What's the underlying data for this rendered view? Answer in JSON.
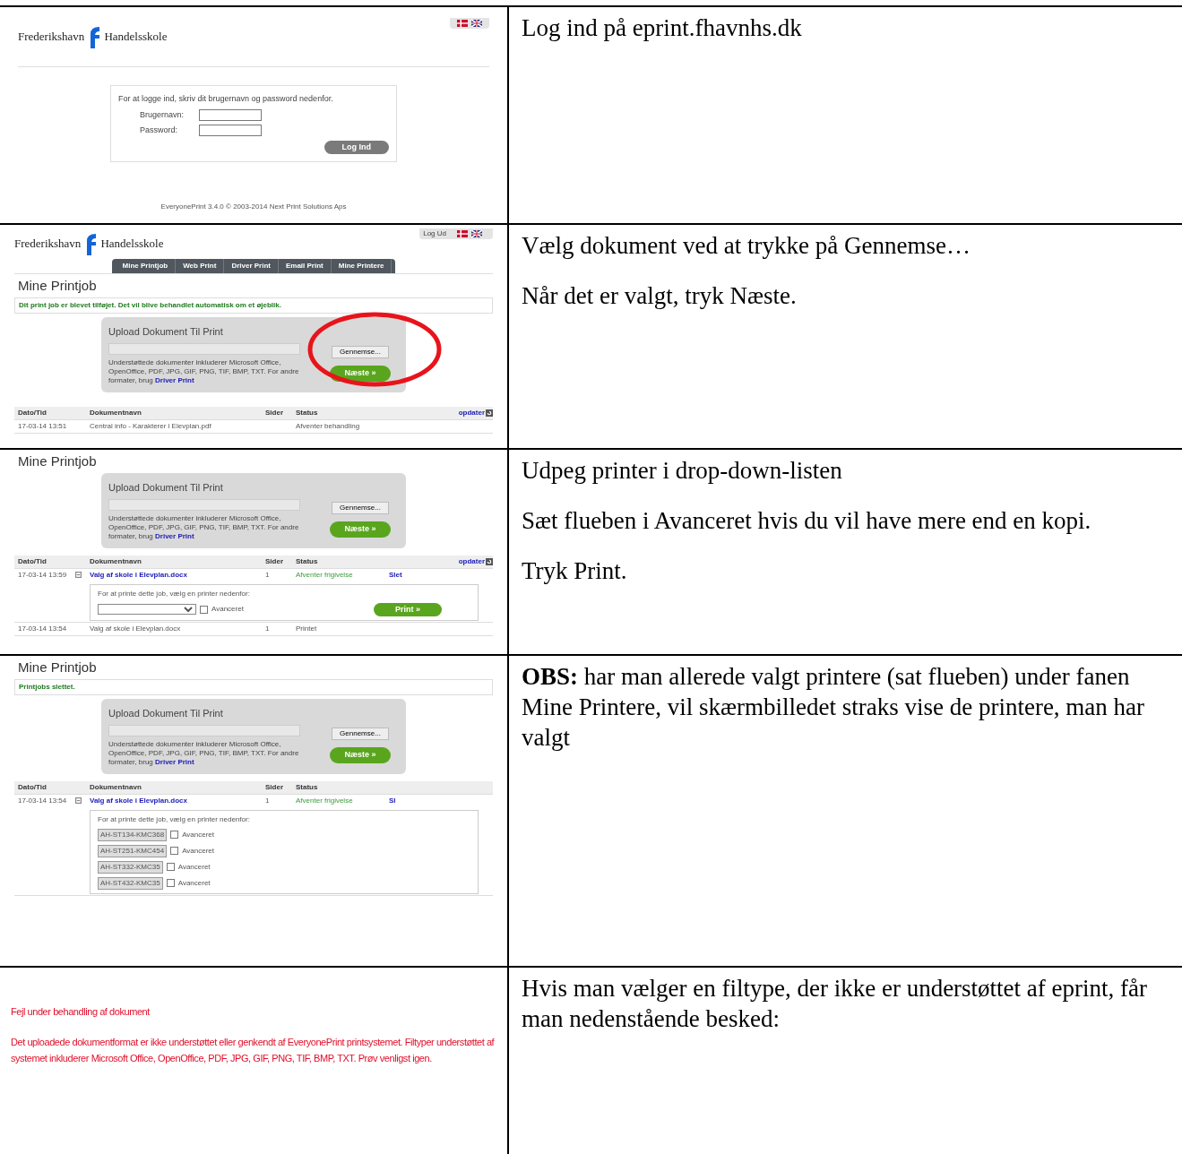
{
  "rows": [
    {
      "kind": "login",
      "shot": {
        "logo": {
          "left": "Frederikshavn",
          "right": "Handelsskole"
        },
        "prompt": "For at logge ind, skriv dit brugernavn og password nedenfor.",
        "fields": [
          {
            "label": "Brugernavn:"
          },
          {
            "label": "Password:"
          }
        ],
        "button": "Log Ind",
        "footer": "EveryonePrint 3.4.0 © 2003-2014 Next Print Solutions Aps"
      },
      "notes": [
        "Log ind på eprint.fhavnhs.dk"
      ]
    },
    {
      "kind": "jobs",
      "shot": {
        "logout": "Log Ud",
        "logo": {
          "left": "Frederikshavn",
          "right": "Handelsskole"
        },
        "tabs": [
          "Mine Printjob",
          "Web Print",
          "Driver Print",
          "Email Print",
          "Mine Printere"
        ],
        "heading": "Mine Printjob",
        "message": "Dit print job er blevet tilføjet. Det vil blive behandlet automatisk om et øjeblik.",
        "upload": {
          "title": "Upload Dokument Til Print",
          "browse": "Gennemse...",
          "info": "Understøttede dokumenter inkluderer Microsoft Office, OpenOffice, PDF, JPG, GIF, PNG, TIF, BMP, TXT. For andre formater, brug ",
          "link": "Driver Print",
          "next": "Næste »"
        },
        "highlight": true,
        "columns": [
          "Dato/Tid",
          "Dokumentnavn",
          "Sider",
          "Status"
        ],
        "refresh": "opdater",
        "jobs": [
          {
            "date": "17-03-14 13:51",
            "name": "Central info - Karakterer i Elevplan.pdf",
            "link": false,
            "pending": false,
            "status": "Afventer behandling"
          }
        ]
      },
      "notes": [
        "Vælg dokument ved at trykke på Gennemse…",
        "Når det er valgt, tryk Næste."
      ]
    },
    {
      "kind": "jobs",
      "shot": {
        "heading": "Mine Printjob",
        "upload": {
          "title": "Upload Dokument Til Print",
          "browse": "Gennemse...",
          "info": "Understøttede dokumenter inkluderer Microsoft Office, OpenOffice, PDF, JPG, GIF, PNG, TIF, BMP, TXT. For andre formater, brug ",
          "link": "Driver Print",
          "next": "Næste »"
        },
        "columns": [
          "Dato/Tid",
          "Dokumentnavn",
          "Sider",
          "Status"
        ],
        "refresh": "opdater",
        "jobs": [
          {
            "date": "17-03-14 13:59",
            "name": "Valg af skole i Elevplan.docx",
            "link": true,
            "expanded": true,
            "pages": "1",
            "pending": true,
            "status": "Afventer frigivelse",
            "action": "Slet",
            "detail": {
              "kind": "select",
              "prompt": "For at printe dette job, vælg en printer nedenfor:",
              "choices": [
                {
                  "advanced": "Avanceret",
                  "checked": false
                }
              ],
              "print": "Print »"
            }
          },
          {
            "date": "17-03-14 13:54",
            "name": "Valg af skole i Elevplan.docx",
            "link": false,
            "pages": "1",
            "pending": false,
            "status": "Printet"
          }
        ]
      },
      "notes": [
        "Udpeg printer i drop-down-listen",
        "Sæt flueben i Avanceret hvis du vil have mere end en kopi.",
        "Tryk Print."
      ]
    },
    {
      "kind": "jobs",
      "shot": {
        "heading": "Mine Printjob",
        "message": "Printjobs slettet.",
        "upload": {
          "title": "Upload Dokument Til Print",
          "browse": "Gennemse...",
          "info": "Understøttede dokumenter inkluderer Microsoft Office, OpenOffice, PDF, JPG, GIF, PNG, TIF, BMP, TXT. For andre formater, brug ",
          "link": "Driver Print",
          "next": "Næste »"
        },
        "columns": [
          "Dato/Tid",
          "Dokumentnavn",
          "Sider",
          "Status"
        ],
        "jobs": [
          {
            "date": "17-03-14 13:54",
            "name": "Valg af skole i Elevplan.docx",
            "link": true,
            "expanded": true,
            "pages": "1",
            "pending": true,
            "status": "Afventer frigivelse",
            "action": "Sl",
            "detail": {
              "kind": "printers",
              "prompt": "For at printe dette job, vælg en printer nedenfor:",
              "choices": [
                {
                  "printer": "AH-ST134-KMC368",
                  "advanced": "Avanceret",
                  "checked": false
                },
                {
                  "printer": "AH-ST251-KMC454",
                  "advanced": "Avanceret",
                  "checked": false
                },
                {
                  "printer": "AH-ST332-KMC35",
                  "advanced": "Avanceret",
                  "checked": false
                },
                {
                  "printer": "AH-ST432-KMC35",
                  "advanced": "Avanceret",
                  "checked": false
                }
              ]
            }
          }
        ]
      },
      "notes": [
        "**OBS:** har man allerede valgt printere (sat flueben) under fanen Mine Printere, vil skærmbilledet straks vise de printere, man har valgt"
      ]
    },
    {
      "kind": "error",
      "shot": {
        "title": "Fejl under behandling af dokument",
        "message": "Det uploadede dokumentformat er ikke understøttet eller genkendt af EveryonePrint printsystemet. Filtyper understøttet af systemet inkluderer Microsoft Office, OpenOffice, PDF, JPG, GIF, PNG, TIF, BMP, TXT. Prøv venligst igen."
      },
      "notes": [
        "Hvis man vælger en filtype, der ikke er understøttet af eprint, får man nedenstående besked:"
      ]
    }
  ]
}
